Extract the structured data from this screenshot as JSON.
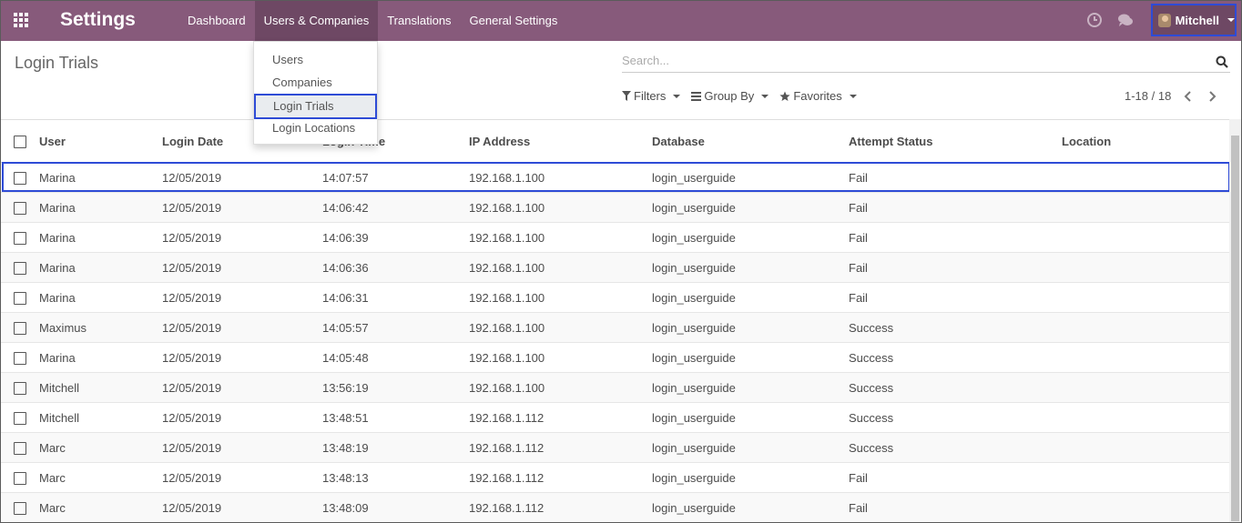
{
  "navbar": {
    "app_title": "Settings",
    "menu": [
      {
        "label": "Dashboard"
      },
      {
        "label": "Users & Companies"
      },
      {
        "label": "Translations"
      },
      {
        "label": "General Settings"
      }
    ],
    "user_name": "Mitchell",
    "bg_color": "#875a7b"
  },
  "dropdown": {
    "items": [
      "Users",
      "Companies",
      "Login Trials",
      "Login Locations"
    ]
  },
  "control_panel": {
    "title": "Login Trials",
    "search_placeholder": "Search...",
    "filters_label": "Filters",
    "group_by_label": "Group By",
    "favorites_label": "Favorites",
    "pager": "1-18 / 18"
  },
  "table": {
    "columns": [
      "User",
      "Login Date",
      "Login Time",
      "IP Address",
      "Database",
      "Attempt Status",
      "Location"
    ],
    "rows": [
      [
        "Marina",
        "12/05/2019",
        "14:07:57",
        "192.168.1.100",
        "login_userguide",
        "Fail",
        ""
      ],
      [
        "Marina",
        "12/05/2019",
        "14:06:42",
        "192.168.1.100",
        "login_userguide",
        "Fail",
        ""
      ],
      [
        "Marina",
        "12/05/2019",
        "14:06:39",
        "192.168.1.100",
        "login_userguide",
        "Fail",
        ""
      ],
      [
        "Marina",
        "12/05/2019",
        "14:06:36",
        "192.168.1.100",
        "login_userguide",
        "Fail",
        ""
      ],
      [
        "Marina",
        "12/05/2019",
        "14:06:31",
        "192.168.1.100",
        "login_userguide",
        "Fail",
        ""
      ],
      [
        "Maximus",
        "12/05/2019",
        "14:05:57",
        "192.168.1.100",
        "login_userguide",
        "Success",
        ""
      ],
      [
        "Marina",
        "12/05/2019",
        "14:05:48",
        "192.168.1.100",
        "login_userguide",
        "Success",
        ""
      ],
      [
        "Mitchell",
        "12/05/2019",
        "13:56:19",
        "192.168.1.100",
        "login_userguide",
        "Success",
        ""
      ],
      [
        "Mitchell",
        "12/05/2019",
        "13:48:51",
        "192.168.1.112",
        "login_userguide",
        "Success",
        ""
      ],
      [
        "Marc",
        "12/05/2019",
        "13:48:19",
        "192.168.1.112",
        "login_userguide",
        "Success",
        ""
      ],
      [
        "Marc",
        "12/05/2019",
        "13:48:13",
        "192.168.1.112",
        "login_userguide",
        "Fail",
        ""
      ],
      [
        "Marc",
        "12/05/2019",
        "13:48:09",
        "192.168.1.112",
        "login_userguide",
        "Fail",
        ""
      ]
    ]
  },
  "icons": {
    "apps": "apps-grid-icon",
    "activity": "clock-icon",
    "discuss": "chat-icon",
    "search": "search-icon"
  }
}
